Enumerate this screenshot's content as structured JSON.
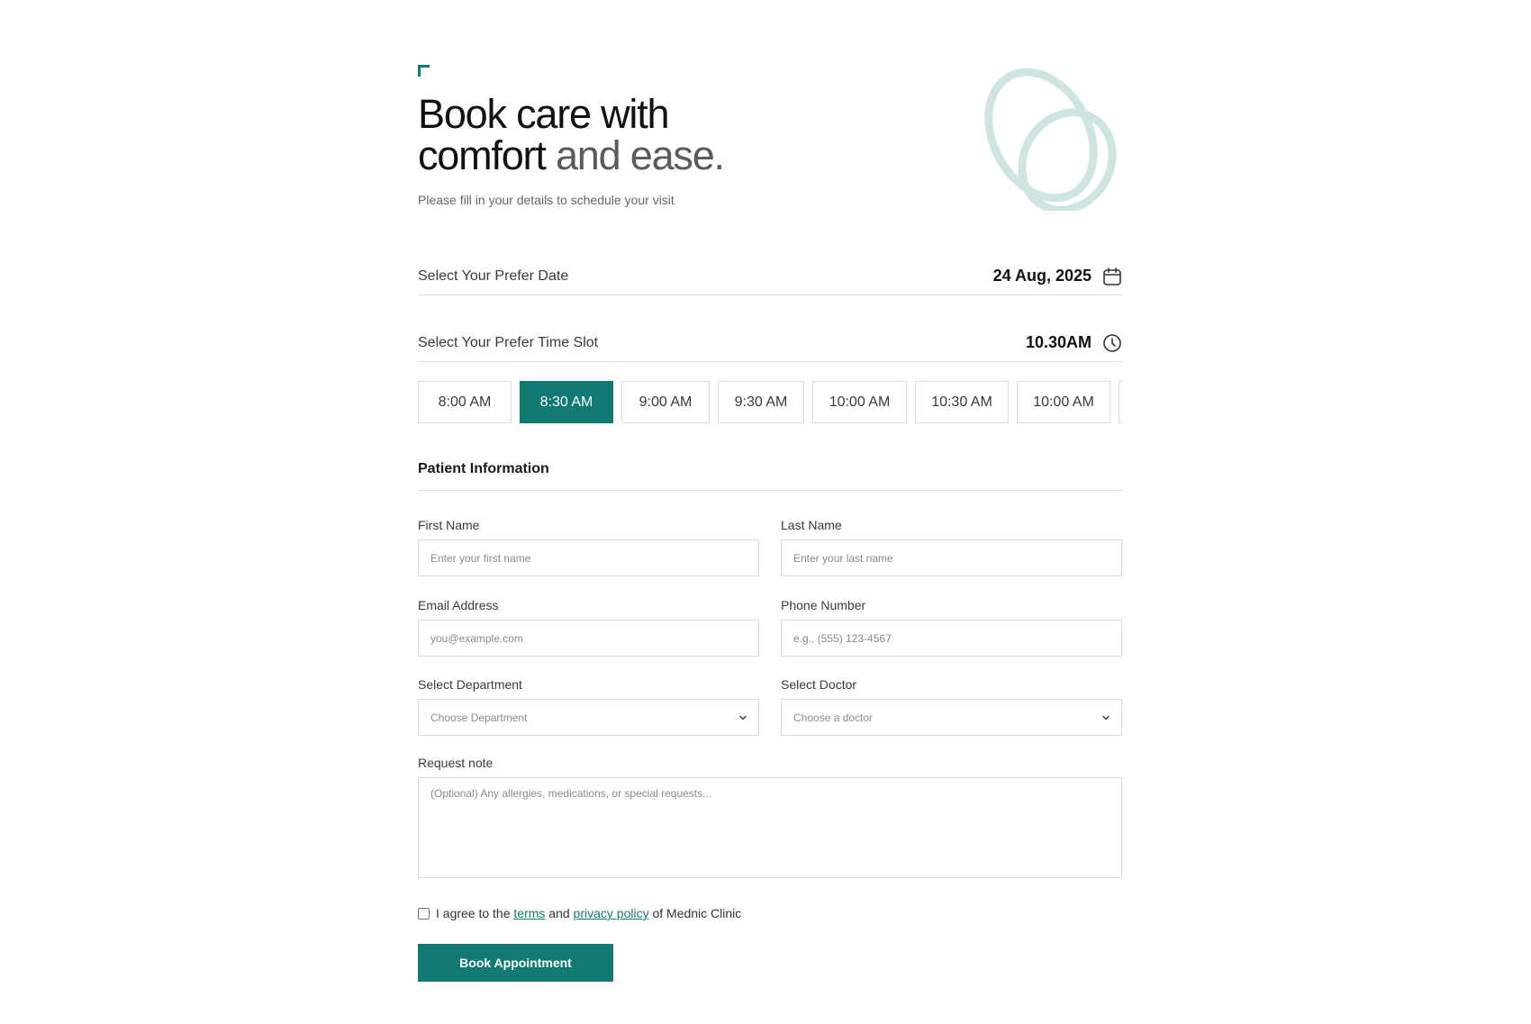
{
  "hero": {
    "title_line1": "Book care with",
    "title_line2_strong": "comfort",
    "title_line2_muted": "and ease.",
    "subtitle": "Please fill in your details to schedule your visit"
  },
  "date": {
    "label": "Select Your Prefer Date",
    "value": "24 Aug, 2025",
    "icon": "calendar-icon"
  },
  "time": {
    "label": "Select Your Prefer Time Slot",
    "value": "10.30AM",
    "icon": "clock-icon",
    "slots": [
      {
        "label": "8:00 AM",
        "selected": false
      },
      {
        "label": "8:30 AM",
        "selected": true
      },
      {
        "label": "9:00 AM",
        "selected": false
      },
      {
        "label": "9:30 AM",
        "selected": false
      },
      {
        "label": "10:00 AM",
        "selected": false
      },
      {
        "label": "10:30 AM",
        "selected": false
      },
      {
        "label": "10:00 AM",
        "selected": false
      }
    ]
  },
  "patient": {
    "section_title": "Patient Information",
    "first_name": {
      "label": "First Name",
      "placeholder": "Enter your first name"
    },
    "last_name": {
      "label": "Last Name",
      "placeholder": "Enter your last name"
    },
    "email": {
      "label": "Email Address",
      "placeholder": "you@example.com"
    },
    "phone": {
      "label": "Phone Number",
      "placeholder": "e.g., (555) 123-4567"
    },
    "department": {
      "label": "Select Department",
      "value": "Choose Department"
    },
    "doctor": {
      "label": "Select Doctor",
      "value": "Choose a doctor"
    },
    "note": {
      "label": "Request note",
      "placeholder": "(Optional) Any allergies, medications, or special requests..."
    }
  },
  "agreement": {
    "prefix": "I agree to the",
    "terms": "terms",
    "and": "and",
    "privacy": "privacy policy",
    "suffix": "of Mednic Clinic",
    "checked": false
  },
  "submit_label": "Book Appointment",
  "colors": {
    "accent": "#117a72",
    "ring": "#cfe5e2"
  }
}
